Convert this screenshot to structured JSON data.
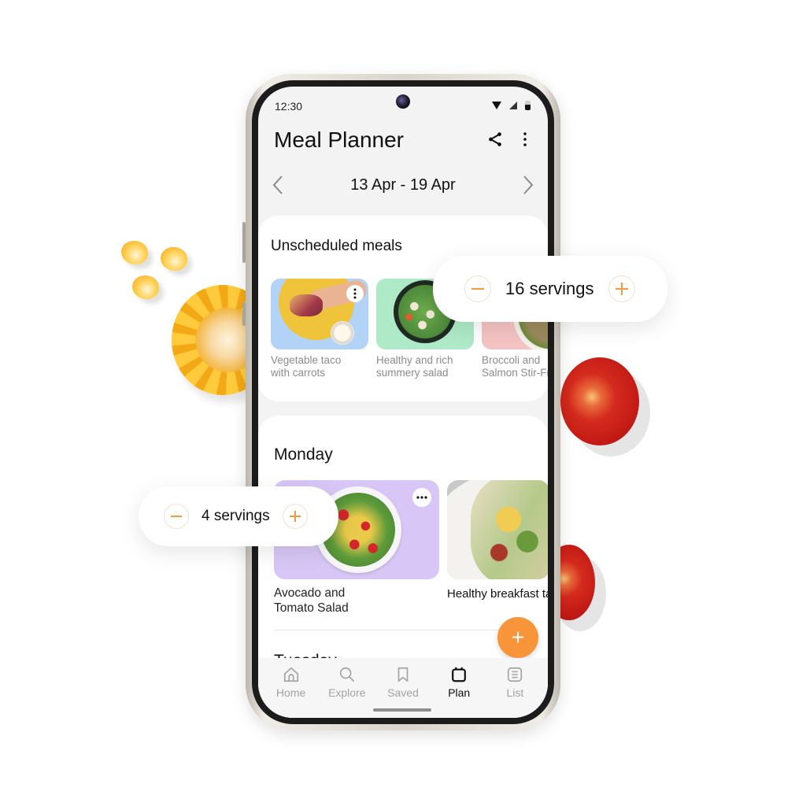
{
  "status_bar": {
    "time": "12:30"
  },
  "header": {
    "title": "Meal Planner"
  },
  "week_nav": {
    "label": "13 Apr - 19 Apr"
  },
  "unscheduled": {
    "title": "Unscheduled meals",
    "meals": [
      {
        "name_line1": "Vegetable taco",
        "name_line2": "with carrots"
      },
      {
        "name_line1": "Healthy and rich",
        "name_line2": "summery salad"
      },
      {
        "name_line1": "Broccoli and",
        "name_line2": "Salmon Stir-Fry"
      }
    ]
  },
  "days": [
    {
      "title": "Monday",
      "meals": [
        {
          "name_line1": "Avocado and",
          "name_line2": "Tomato Salad"
        },
        {
          "name_line1": "Healthy breakfast taco",
          "name_line2": ""
        }
      ]
    },
    {
      "title": "Tuesday"
    }
  ],
  "fab": {
    "label": "+"
  },
  "bottom_nav": {
    "items": [
      {
        "label": "Home",
        "icon": "home-icon",
        "active": false
      },
      {
        "label": "Explore",
        "icon": "search-icon",
        "active": false
      },
      {
        "label": "Saved",
        "icon": "bookmark-icon",
        "active": false
      },
      {
        "label": "Plan",
        "icon": "calendar-icon",
        "active": true
      },
      {
        "label": "List",
        "icon": "list-icon",
        "active": false
      }
    ]
  },
  "servings_pills": [
    {
      "value": 16,
      "text": "16 servings"
    },
    {
      "value": 4,
      "text": "4 servings"
    }
  ],
  "colors": {
    "accent": "#f8943a",
    "screen_bg": "#f3f3f3",
    "card_bg": "#ffffff",
    "muted_text": "#8b8b8b"
  }
}
